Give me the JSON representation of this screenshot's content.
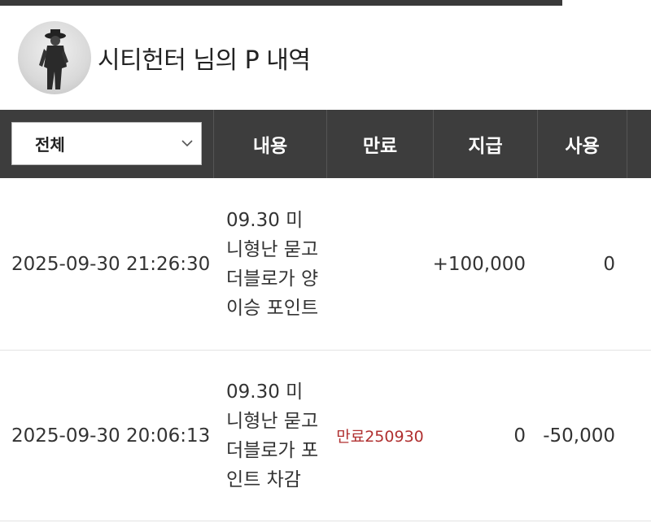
{
  "profile": {
    "title": "시티헌터 님의 P 내역"
  },
  "filter": {
    "selected": "전체"
  },
  "table": {
    "headers": {
      "content": "내용",
      "expire": "만료",
      "grant": "지급",
      "use": "사용"
    },
    "rows": [
      {
        "date": "2025-09-30 21:26:30",
        "content": "09.30 미니형난 묻고더블로가 양이승 포인트",
        "expire": "",
        "grant": "+100,000",
        "use": "0"
      },
      {
        "date": "2025-09-30 20:06:13",
        "content": "09.30 미니형난 묻고더블로가 포인트 차감",
        "expire": "만료250930",
        "grant": "0",
        "use": "-50,000"
      }
    ]
  },
  "colors": {
    "header_bg": "#3d3d3d",
    "expire_text": "#b03030"
  },
  "icons": {
    "select_arrow": "chevron-down-icon"
  }
}
